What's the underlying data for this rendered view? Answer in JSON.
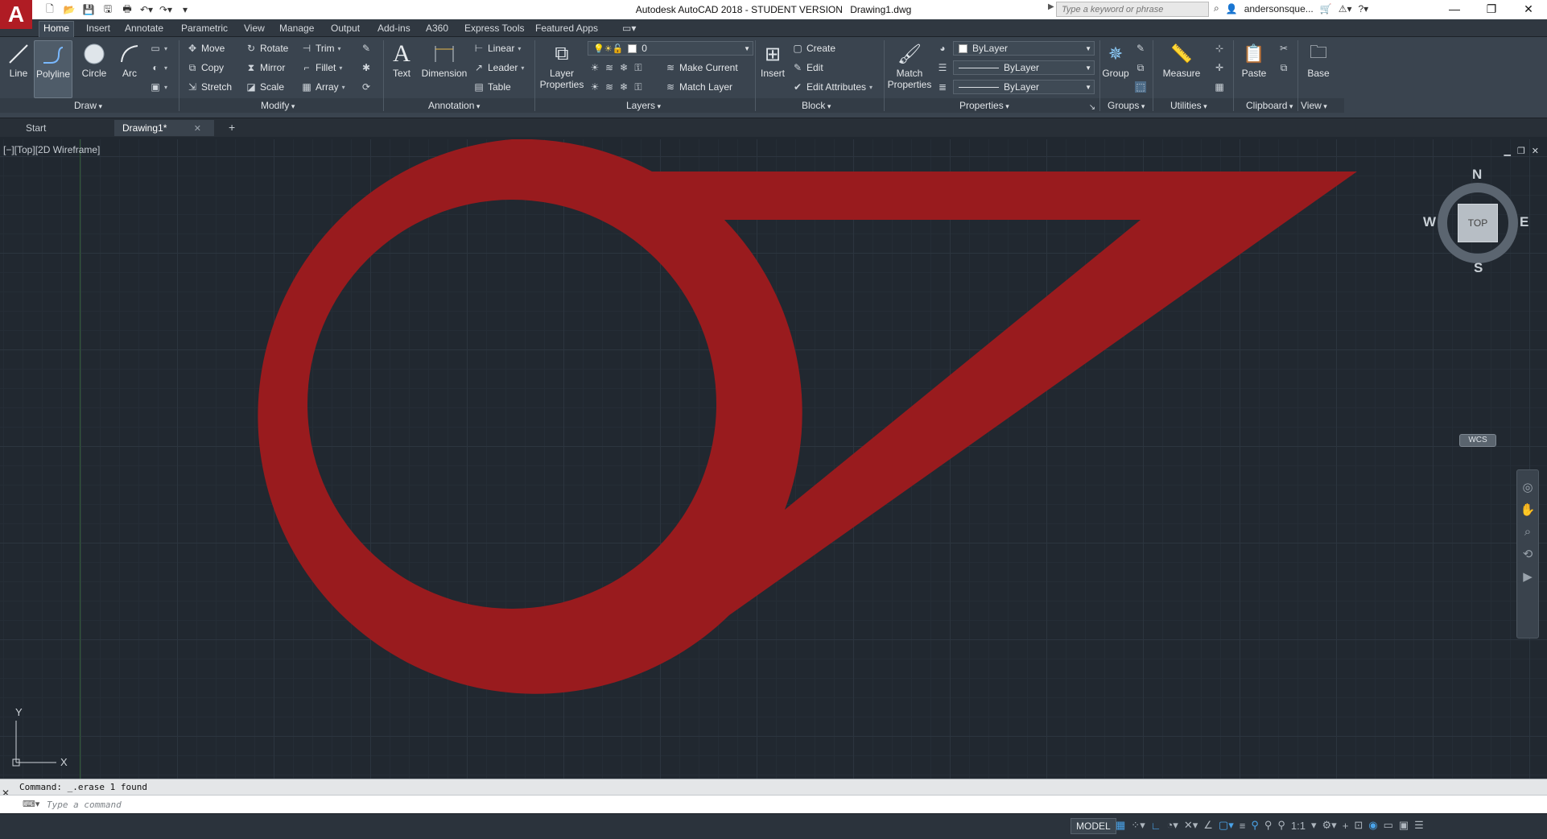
{
  "app": {
    "title": "Autodesk AutoCAD 2018 - STUDENT VERSION",
    "document": "Drawing1.dwg",
    "logo": "A",
    "search_placeholder": "Type a keyword or phrase",
    "user": "andersonsque..."
  },
  "ribbon_tabs": [
    "Home",
    "Insert",
    "Annotate",
    "Parametric",
    "View",
    "Manage",
    "Output",
    "Add-ins",
    "A360",
    "Express Tools",
    "Featured Apps"
  ],
  "ribbon": {
    "draw": {
      "title": "Draw",
      "line": "Line",
      "polyline": "Polyline",
      "circle": "Circle",
      "arc": "Arc"
    },
    "modify": {
      "title": "Modify",
      "move": "Move",
      "rotate": "Rotate",
      "trim": "Trim",
      "copy": "Copy",
      "mirror": "Mirror",
      "fillet": "Fillet",
      "stretch": "Stretch",
      "scale": "Scale",
      "array": "Array"
    },
    "annotation": {
      "title": "Annotation",
      "text": "Text",
      "dimension": "Dimension",
      "linear": "Linear",
      "leader": "Leader",
      "table": "Table"
    },
    "layers": {
      "title": "Layers",
      "layer_properties": "Layer Properties",
      "current_layer": "0",
      "make_current": "Make Current",
      "match_layer": "Match Layer"
    },
    "block": {
      "title": "Block",
      "insert": "Insert",
      "create": "Create",
      "edit": "Edit",
      "edit_attributes": "Edit Attributes"
    },
    "properties": {
      "title": "Properties",
      "match_properties": "Match Properties",
      "color": "ByLayer",
      "linetype": "ByLayer",
      "lineweight": "ByLayer"
    },
    "groups": {
      "title": "Groups",
      "group": "Group"
    },
    "utilities": {
      "title": "Utilities",
      "measure": "Measure"
    },
    "clipboard": {
      "title": "Clipboard",
      "paste": "Paste"
    },
    "view": {
      "title": "View",
      "base": "Base"
    }
  },
  "file_tabs": {
    "start": "Start",
    "drawing": "Drawing1*"
  },
  "viewport": {
    "label": "[−][Top][2D Wireframe]",
    "viewcube": {
      "face": "TOP",
      "n": "N",
      "s": "S",
      "e": "E",
      "w": "W"
    },
    "wcs": "WCS",
    "ucs_x": "X",
    "ucs_y": "Y",
    "shape_color": "#991b1e"
  },
  "command": {
    "history": "Command: _.erase 1 found",
    "placeholder": "Type a command"
  },
  "status": {
    "model": "MODEL",
    "scale": "1:1"
  },
  "colors": {
    "canvas_bg": "#212830",
    "ribbon_bg": "#3a444f",
    "logo_red": "#b01c24"
  }
}
